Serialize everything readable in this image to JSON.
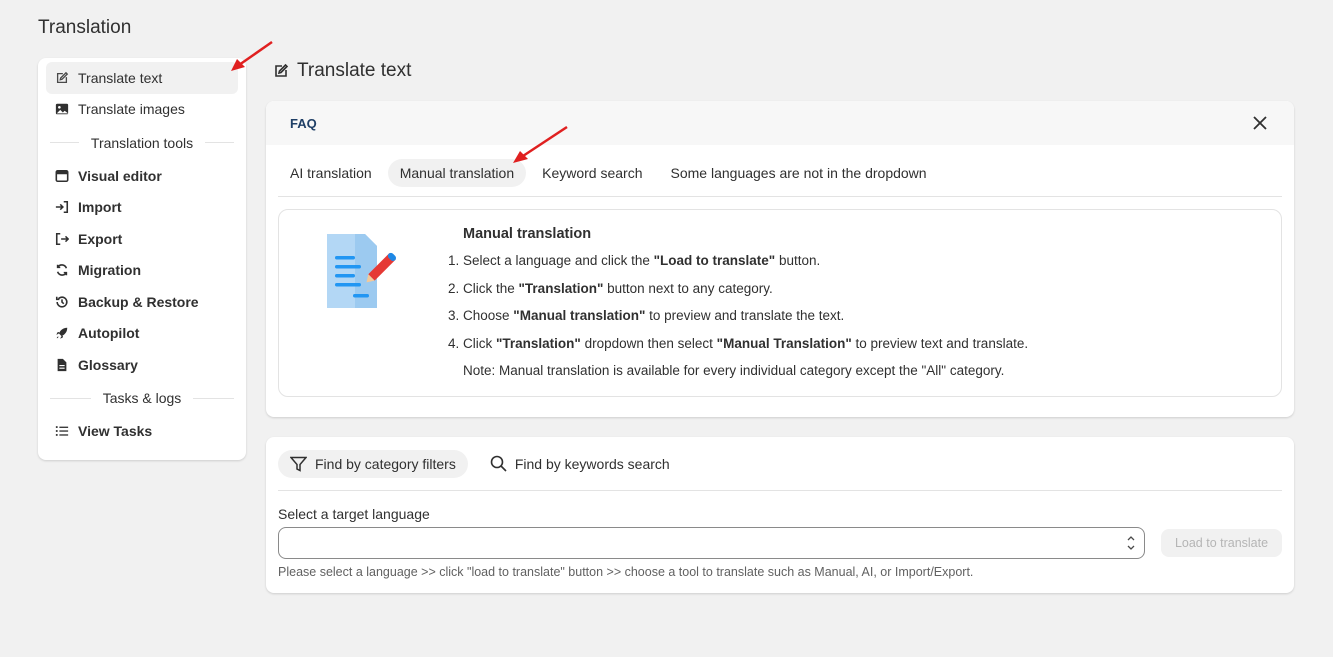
{
  "page": {
    "title": "Translation"
  },
  "sidebar": {
    "items_top": [
      {
        "label": "Translate text",
        "icon": "edit-icon",
        "active": true
      },
      {
        "label": "Translate images",
        "icon": "image-icon"
      }
    ],
    "section_tools": "Translation tools",
    "items_tools": [
      {
        "label": "Visual editor",
        "icon": "calendar-icon"
      },
      {
        "label": "Import",
        "icon": "import-icon"
      },
      {
        "label": "Export",
        "icon": "export-icon"
      },
      {
        "label": "Migration",
        "icon": "refresh-icon"
      },
      {
        "label": "Backup & Restore",
        "icon": "history-icon"
      },
      {
        "label": "Autopilot",
        "icon": "rocket-icon"
      },
      {
        "label": "Glossary",
        "icon": "document-icon"
      }
    ],
    "section_tasks": "Tasks & logs",
    "items_tasks": [
      {
        "label": "View Tasks",
        "icon": "list-icon"
      }
    ]
  },
  "main": {
    "title": "Translate text",
    "faq": {
      "label": "FAQ",
      "tabs": [
        "AI translation",
        "Manual translation",
        "Keyword search",
        "Some languages are not in the dropdown"
      ],
      "active_tab": "Manual translation",
      "heading": "Manual translation",
      "steps": [
        {
          "pre": "Select a language and click the ",
          "bold": "\"Load to translate\"",
          "post": " button."
        },
        {
          "pre": "Click the ",
          "bold": "\"Translation\"",
          "post": " button next to any category."
        },
        {
          "pre": "Choose ",
          "bold": "\"Manual translation\"",
          "post": " to preview and translate the text."
        },
        {
          "pre": "Click ",
          "bold": "\"Translation\"",
          "mid": " dropdown then select ",
          "bold2": "\"Manual Translation\"",
          "post": " to preview text and translate."
        }
      ],
      "note": "Note: Manual translation is available for every individual category except the \"All\" category."
    },
    "search": {
      "filter_category": "Find by category filters",
      "filter_keywords": "Find by keywords search",
      "language_label": "Select a target language",
      "language_value": "",
      "load_button": "Load to translate",
      "hint": "Please select a language >> click \"load to translate\" button >> choose a tool to translate such as Manual, AI, or Import/Export."
    }
  },
  "colors": {
    "accent_arrow": "#e02020",
    "faq_label": "#1f3f66"
  }
}
